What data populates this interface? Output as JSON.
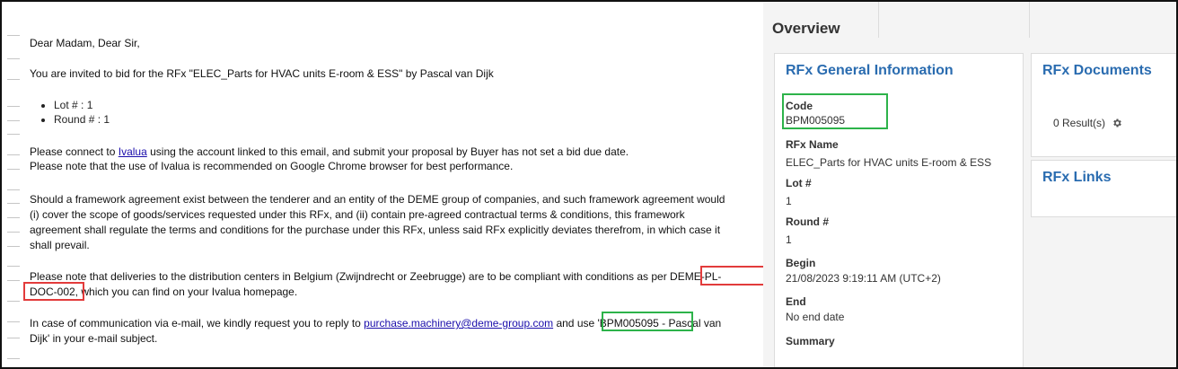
{
  "email": {
    "greeting": "Dear Madam, Dear Sir,",
    "invite": "You are invited to bid for the RFx \"ELEC_Parts for HVAC units E-room & ESS\" by Pascal van Dijk",
    "bullets": [
      "Lot # : 1",
      "Round # : 1"
    ],
    "connect_before": "Please connect to ",
    "connect_link": "Ivalua",
    "connect_after": " using the account linked to this email, and submit your proposal by Buyer has not set a bid due date.",
    "chrome_note": "Please note that the use of Ivalua is recommended on Google Chrome browser for best performance.",
    "framework": [
      "Should a framework agreement exist between the tenderer and an entity of the DEME group of companies, and such framework agreement would",
      "(i) cover the scope of goods/services requested under this RFx, and (ii) contain pre-agreed contractual terms & conditions, this framework",
      "agreement shall regulate the terms and conditions for the purchase under this RFx, unless said RFx explicitly deviates therefrom, in which case it",
      "shall prevail."
    ],
    "delivery_line1": "Please note that deliveries to the distribution centers in Belgium (Zwijndrecht or Zeebrugge) are to be compliant with conditions as per DEME-PL-",
    "delivery_line2": "DOC-002, which you can find on your Ivalua homepage.",
    "contact_before": "In case of communication via e-mail, we kindly request you to reply to ",
    "contact_email": "purchase.machinery@deme-group.com",
    "contact_after": " and use 'BPM005095 - Pascal van",
    "contact_line2": "Dijk' in your e-mail subject."
  },
  "panel": {
    "overview_title": "Overview",
    "general": {
      "title": "RFx General Information",
      "fields": [
        {
          "label": "Code",
          "value": "BPM005095"
        },
        {
          "label": "RFx Name",
          "value": "ELEC_Parts for HVAC units E-room & ESS"
        },
        {
          "label": "Lot #",
          "value": "1"
        },
        {
          "label": "Round #",
          "value": "1"
        },
        {
          "label": "Begin",
          "value": "21/08/2023 9:19:11 AM (UTC+2)"
        },
        {
          "label": "End",
          "value": "No end date"
        },
        {
          "label": "Summary",
          "value": ""
        }
      ]
    },
    "documents": {
      "title": "RFx Documents",
      "results": "0 Result(s)",
      "icon": "gear-icon"
    },
    "links": {
      "title": "RFx Links"
    }
  },
  "colors": {
    "highlight_red": "#e23b3b",
    "highlight_green": "#2db34a",
    "card_title": "#2a6cb0",
    "link": "#1a0dab"
  }
}
